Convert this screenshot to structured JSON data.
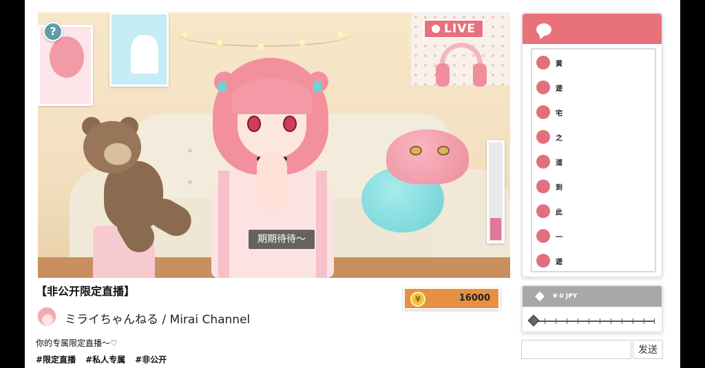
{
  "stream": {
    "live_label": "LIVE",
    "subtitle": "期期待待～",
    "gauge_level_pct": 22
  },
  "chat": {
    "messages": [
      "黄",
      "遊",
      "宅",
      "之",
      "道",
      "到",
      "此",
      "一",
      "遊"
    ]
  },
  "donation": {
    "amount_label": "¥ 0 JPY",
    "slider_value": 0
  },
  "message_input": {
    "value": ""
  },
  "send_label": "发送",
  "info": {
    "title": "【非公开限定直播】",
    "channel_name": "ミライちゃんねる / Mirai Channel",
    "description": "你的专属限定直播～♡",
    "tags": [
      "#限定直播",
      "#私人专属",
      "#非公开"
    ]
  },
  "coins": {
    "symbol": "¥",
    "value": "16000"
  },
  "colors": {
    "accent": "#e8717b",
    "coin_bg": "#e59043"
  },
  "icons": {
    "help": "question-icon",
    "chat": "chat-bubble-icon",
    "coin": "yen-coin-icon",
    "donation": "diamond-icon",
    "live": "live-dot-icon"
  }
}
